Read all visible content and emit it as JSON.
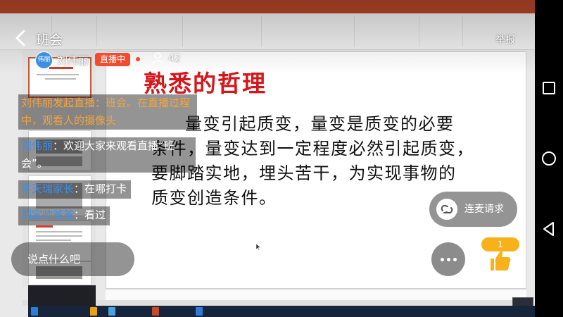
{
  "room": {
    "title": "班会",
    "report_label": "举报"
  },
  "host": {
    "avatar_text": "伟丽",
    "name": "刘伟丽",
    "live_badge": "直播中",
    "viewer_count": "42"
  },
  "chat": [
    {
      "name": "",
      "text": "刘伟丽发起直播：班会。在直播过程中，观看人的摄像头"
    },
    {
      "name": "刘伟丽",
      "text": "：欢迎大家来观看直播“班会”。"
    },
    {
      "name": "牛天瑞家长",
      "text": "：在哪打卡"
    },
    {
      "name": "刘宜帅爸爸",
      "text": "：看过"
    }
  ],
  "comment": {
    "placeholder": "说点什么吧"
  },
  "actions": {
    "connect_mic_label": "连麦请求",
    "like_count": "1"
  },
  "slide": {
    "title": "熟悉的哲理",
    "lines": [
      "量变引起质变，量变是质变的必要",
      "条件，量变达到一定程度必然引起质变，",
      "要脚踏实地，埋头苦干，为实现事物的",
      "质变创造条件。"
    ]
  },
  "icons": {
    "back": "chevron-left-icon",
    "viewers": "person-icon",
    "connect_mic": "link-icon",
    "more": "ellipsis-icon",
    "like": "thumbs-up-icon",
    "nav_recent": "square-icon",
    "nav_home": "circle-icon",
    "nav_back": "triangle-icon"
  },
  "colors": {
    "live_badge": "#f24b2d",
    "system_name": "#f5a33a",
    "user_name": "#3b8fef",
    "like_bubble": "#f7b21b",
    "slide_title": "#d5161a",
    "ppt_accent": "#b7472a"
  }
}
